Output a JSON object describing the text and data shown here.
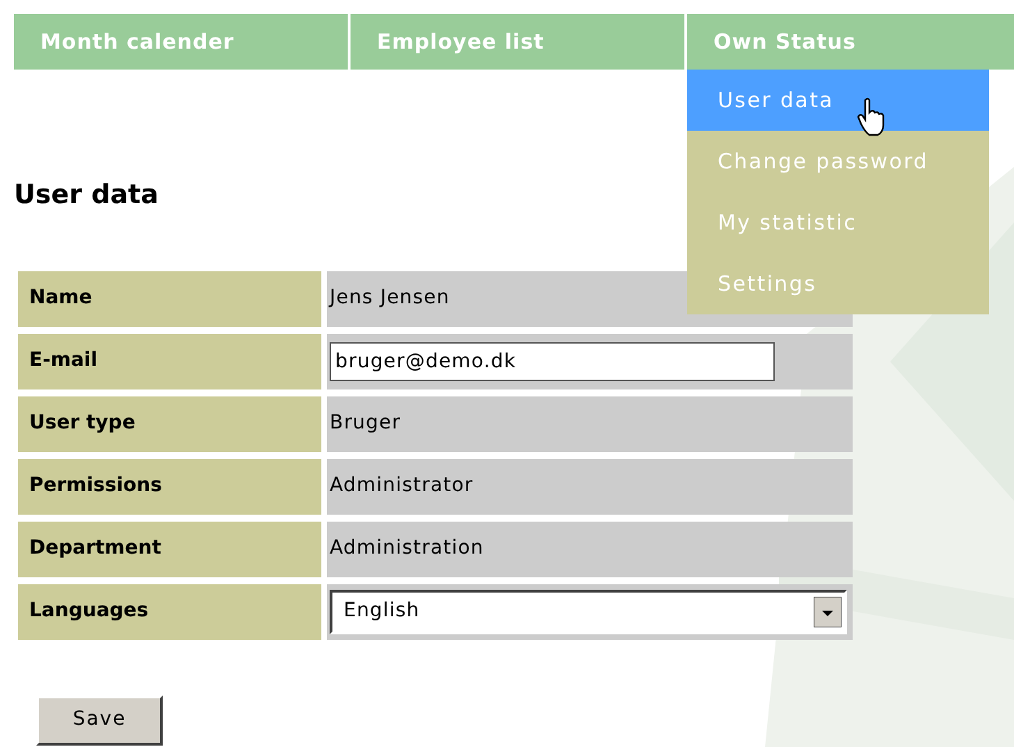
{
  "nav": {
    "tabs": [
      {
        "label": "Month calender"
      },
      {
        "label": "Employee list"
      },
      {
        "label": "Own Status",
        "menu": {
          "items": [
            {
              "label": "User data",
              "selected": true
            },
            {
              "label": "Change password",
              "selected": false
            },
            {
              "label": "My statistic",
              "selected": false
            },
            {
              "label": "Settings",
              "selected": false
            }
          ]
        }
      }
    ]
  },
  "heading": "User data",
  "form": {
    "rows": [
      {
        "kind": "text",
        "label": "Name",
        "value": "Jens Jensen"
      },
      {
        "kind": "input",
        "label": "E-mail",
        "value": "bruger@demo.dk"
      },
      {
        "kind": "text",
        "label": "User type",
        "value": "Bruger"
      },
      {
        "kind": "text",
        "label": "Permissions",
        "value": "Administrator"
      },
      {
        "kind": "text",
        "label": "Department",
        "value": "Administration"
      },
      {
        "kind": "select",
        "label": "Languages",
        "value": "English"
      }
    ]
  },
  "save_button": "Save"
}
